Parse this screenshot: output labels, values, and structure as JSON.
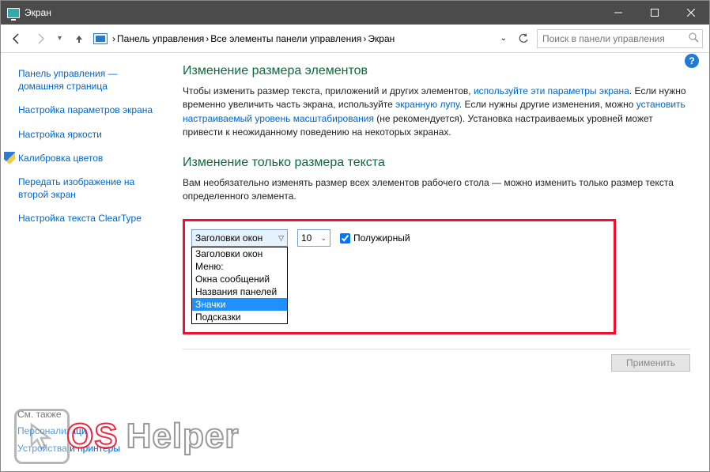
{
  "title": "Экран",
  "breadcrumb": [
    "Панель управления",
    "Все элементы панели управления",
    "Экран"
  ],
  "search_placeholder": "Поиск в панели управления",
  "sidebar": {
    "items": [
      "Панель управления — домашняя страница",
      "Настройка параметров экрана",
      "Настройка яркости",
      "Калибровка цветов",
      "Передать изображение на второй экран",
      "Настройка текста ClearType"
    ]
  },
  "section1": {
    "heading": "Изменение размера элементов",
    "text_a": "Чтобы изменить размер текста, приложений и других элементов, ",
    "link_a": "используйте эти параметры экрана",
    "text_b": ". Если нужно временно увеличить часть экрана, используйте ",
    "link_b": "экранную лупу",
    "text_c": ". Если нужны другие изменения, можно ",
    "link_c": "установить настраиваемый уровень масштабирования",
    "text_d": " (не рекомендуется). Установка настраиваемых уровней может привести к неожиданному поведению на некоторых экранах."
  },
  "section2": {
    "heading": "Изменение только размера текста",
    "text": "Вам необязательно изменять размер всех элементов рабочего стола — можно изменить только размер текста определенного элемента."
  },
  "controls": {
    "combo_value": "Заголовки окон",
    "size_value": "10",
    "bold_label": "Полужирный",
    "options": [
      "Заголовки окон",
      "Меню:",
      "Окна сообщений",
      "Названия панелей",
      "Значки",
      "Подсказки"
    ],
    "selected_index": 4
  },
  "apply_label": "Применить",
  "footer": {
    "heading": "См. также",
    "links": [
      "Персонализация",
      "Устройства и принтеры"
    ]
  },
  "watermark": {
    "os": "OS",
    "helper": "Helper"
  }
}
